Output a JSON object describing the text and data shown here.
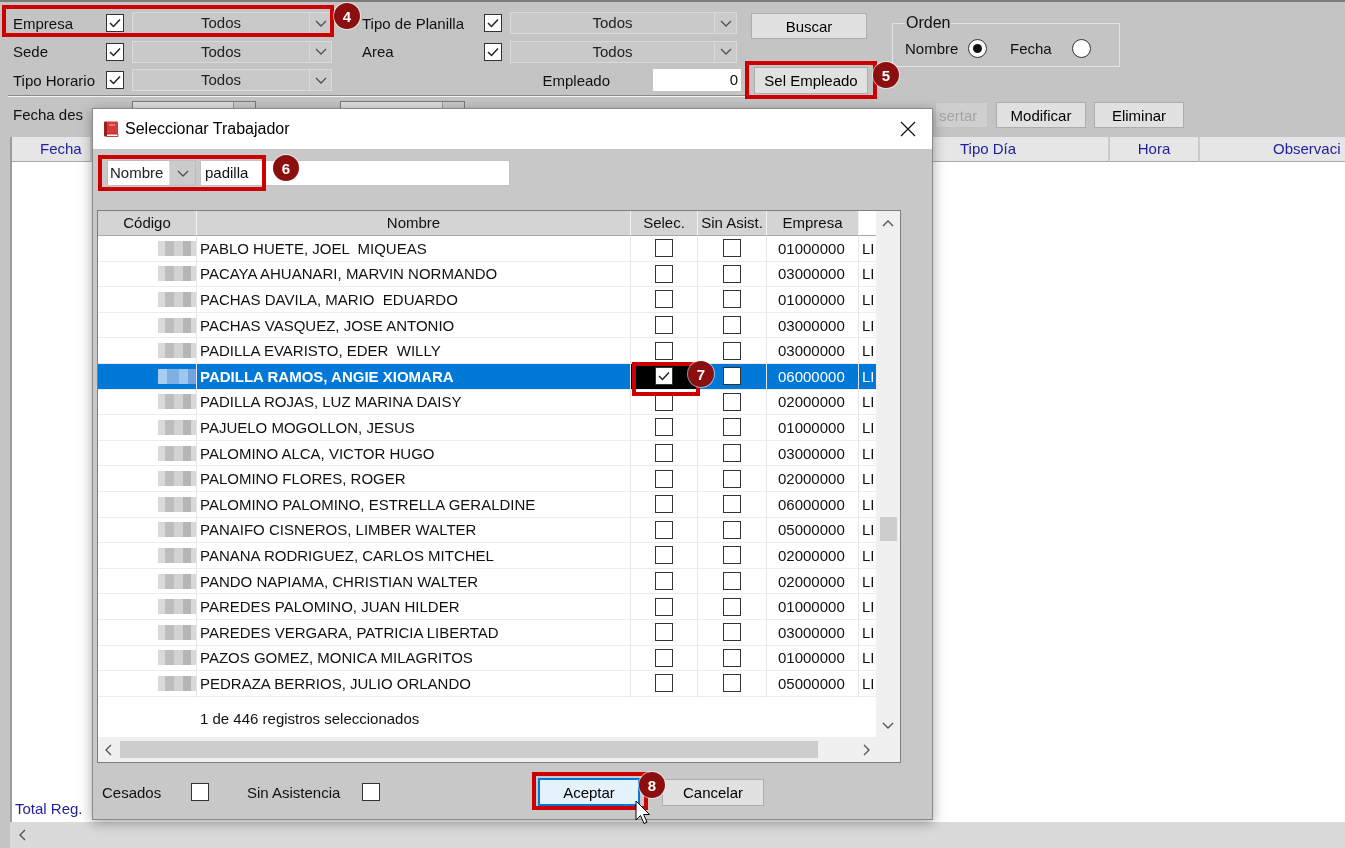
{
  "filters_left": [
    {
      "label": "Empresa",
      "checked": true,
      "value": "Todos",
      "annotation": "4"
    },
    {
      "label": "Sede",
      "checked": true,
      "value": "Todos"
    },
    {
      "label": "Tipo Horario",
      "checked": true,
      "value": "Todos"
    }
  ],
  "filters_right": [
    {
      "label": "Tipo de Planilla",
      "checked": true,
      "value": "Todos"
    },
    {
      "label": "Area",
      "checked": true,
      "value": "Todos"
    }
  ],
  "employee": {
    "label": "Empleado",
    "value": "0"
  },
  "search_button": {
    "label": "Buscar"
  },
  "select_employee_button": {
    "label": "Sel Empleado",
    "annotation": "5"
  },
  "order": {
    "title": "Orden",
    "options": [
      {
        "label": "Nombre",
        "selected": true
      },
      {
        "label": "Fecha",
        "selected": false
      }
    ]
  },
  "date_filter": {
    "label": "Fecha des"
  },
  "actions": [
    {
      "label": "sertar",
      "disabled": true
    },
    {
      "label": "Modificar",
      "disabled": false
    },
    {
      "label": "Eliminar",
      "disabled": false
    }
  ],
  "table": {
    "columns": [
      "Fecha",
      "Tipo Día",
      "Hora",
      "Observaci"
    ],
    "total_label": "Total Reg."
  },
  "dialog": {
    "title": "Seleccionar Trabajador",
    "search": {
      "field": "Nombre",
      "value": "padilla",
      "annotation": "6"
    },
    "columns": [
      "Código",
      "Nombre",
      "Selec.",
      "Sin Asist.",
      "Empresa"
    ],
    "rows": [
      {
        "name": "PABLO HUETE, JOEL  MIQUEAS",
        "selected": false,
        "selec_checked": false,
        "sin_asist_checked": false,
        "empresa": "01000000",
        "column_6": "LI"
      },
      {
        "name": "PACAYA AHUANARI, MARVIN NORMANDO",
        "selected": false,
        "selec_checked": false,
        "sin_asist_checked": false,
        "empresa": "03000000",
        "column_6": "LI"
      },
      {
        "name": "PACHAS DAVILA, MARIO  EDUARDO",
        "selected": false,
        "selec_checked": false,
        "sin_asist_checked": false,
        "empresa": "01000000",
        "column_6": "LI"
      },
      {
        "name": "PACHAS VASQUEZ, JOSE ANTONIO",
        "selected": false,
        "selec_checked": false,
        "sin_asist_checked": false,
        "empresa": "03000000",
        "column_6": "LI"
      },
      {
        "name": "PADILLA EVARISTO, EDER  WILLY",
        "selected": false,
        "selec_checked": false,
        "sin_asist_checked": false,
        "empresa": "03000000",
        "column_6": "LI"
      },
      {
        "name": "PADILLA RAMOS, ANGIE XIOMARA",
        "selected": true,
        "selec_checked": true,
        "sin_asist_checked": false,
        "empresa": "06000000",
        "column_6": "LI",
        "annotation": "7"
      },
      {
        "name": "PADILLA ROJAS, LUZ MARINA DAISY",
        "selected": false,
        "selec_checked": false,
        "sin_asist_checked": false,
        "empresa": "02000000",
        "column_6": "LI"
      },
      {
        "name": "PAJUELO MOGOLLON, JESUS",
        "selected": false,
        "selec_checked": false,
        "sin_asist_checked": false,
        "empresa": "01000000",
        "column_6": "LI"
      },
      {
        "name": "PALOMINO ALCA, VICTOR HUGO",
        "selected": false,
        "selec_checked": false,
        "sin_asist_checked": false,
        "empresa": "03000000",
        "column_6": "LI"
      },
      {
        "name": "PALOMINO FLORES, ROGER",
        "selected": false,
        "selec_checked": false,
        "sin_asist_checked": false,
        "empresa": "02000000",
        "column_6": "LI"
      },
      {
        "name": "PALOMINO PALOMINO, ESTRELLA GERALDINE",
        "selected": false,
        "selec_checked": false,
        "sin_asist_checked": false,
        "empresa": "06000000",
        "column_6": "LI"
      },
      {
        "name": "PANAIFO CISNEROS, LIMBER WALTER",
        "selected": false,
        "selec_checked": false,
        "sin_asist_checked": false,
        "empresa": "05000000",
        "column_6": "LI"
      },
      {
        "name": "PANANA RODRIGUEZ, CARLOS MITCHEL",
        "selected": false,
        "selec_checked": false,
        "sin_asist_checked": false,
        "empresa": "02000000",
        "column_6": "LI"
      },
      {
        "name": "PANDO NAPIAMA, CHRISTIAN WALTER",
        "selected": false,
        "selec_checked": false,
        "sin_asist_checked": false,
        "empresa": "02000000",
        "column_6": "LI"
      },
      {
        "name": "PAREDES PALOMINO, JUAN HILDER",
        "selected": false,
        "selec_checked": false,
        "sin_asist_checked": false,
        "empresa": "01000000",
        "column_6": "LI"
      },
      {
        "name": "PAREDES VERGARA, PATRICIA LIBERTAD",
        "selected": false,
        "selec_checked": false,
        "sin_asist_checked": false,
        "empresa": "03000000",
        "column_6": "LI"
      },
      {
        "name": "PAZOS GOMEZ, MONICA MILAGRITOS",
        "selected": false,
        "selec_checked": false,
        "sin_asist_checked": false,
        "empresa": "01000000",
        "column_6": "LI"
      },
      {
        "name": "PEDRAZA BERRIOS, JULIO ORLANDO",
        "selected": false,
        "selec_checked": false,
        "sin_asist_checked": false,
        "empresa": "05000000",
        "column_6": "LI"
      }
    ],
    "status": "1 de 446 registros seleccionados",
    "options": [
      {
        "label": "Cesados",
        "checked": false
      },
      {
        "label": "Sin Asistencia",
        "checked": false
      }
    ],
    "buttons": [
      {
        "label": "Aceptar",
        "focused": true,
        "annotation": "8"
      },
      {
        "label": "Cancelar",
        "focused": false
      }
    ]
  }
}
